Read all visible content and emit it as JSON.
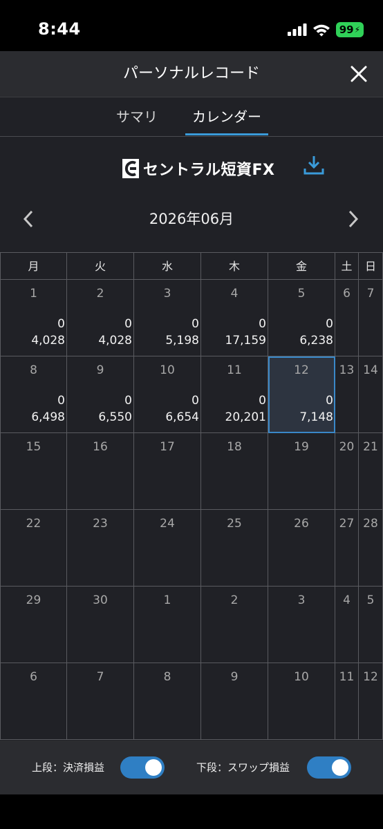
{
  "status_bar": {
    "time": "8:44",
    "battery": "99"
  },
  "header": {
    "title": "パーソナルレコード"
  },
  "tabs": [
    {
      "label": "サマリ",
      "active": false
    },
    {
      "label": "カレンダー",
      "active": true
    }
  ],
  "brand": {
    "name": "セントラル短資FX"
  },
  "month": {
    "label": "2026年06月"
  },
  "weekdays": [
    "月",
    "火",
    "水",
    "木",
    "金",
    "土",
    "日"
  ],
  "weeks": [
    {
      "days": [
        {
          "day": "1",
          "v1": "0",
          "v2": "4,028"
        },
        {
          "day": "2",
          "v1": "0",
          "v2": "4,028"
        },
        {
          "day": "3",
          "v1": "0",
          "v2": "5,198"
        },
        {
          "day": "4",
          "v1": "0",
          "v2": "17,159"
        },
        {
          "day": "5",
          "v1": "0",
          "v2": "6,238"
        },
        {
          "day": "6"
        },
        {
          "day": "7"
        }
      ]
    },
    {
      "days": [
        {
          "day": "8",
          "v1": "0",
          "v2": "6,498"
        },
        {
          "day": "9",
          "v1": "0",
          "v2": "6,550"
        },
        {
          "day": "10",
          "v1": "0",
          "v2": "6,654"
        },
        {
          "day": "11",
          "v1": "0",
          "v2": "20,201"
        },
        {
          "day": "12",
          "v1": "0",
          "v2": "7,148",
          "today": true
        },
        {
          "day": "13"
        },
        {
          "day": "14"
        }
      ]
    },
    {
      "days": [
        {
          "day": "15"
        },
        {
          "day": "16"
        },
        {
          "day": "17"
        },
        {
          "day": "18"
        },
        {
          "day": "19"
        },
        {
          "day": "20"
        },
        {
          "day": "21"
        }
      ]
    },
    {
      "days": [
        {
          "day": "22"
        },
        {
          "day": "23"
        },
        {
          "day": "24"
        },
        {
          "day": "25"
        },
        {
          "day": "26"
        },
        {
          "day": "27"
        },
        {
          "day": "28"
        }
      ]
    },
    {
      "days": [
        {
          "day": "29"
        },
        {
          "day": "30"
        },
        {
          "day": "1"
        },
        {
          "day": "2"
        },
        {
          "day": "3"
        },
        {
          "day": "4"
        },
        {
          "day": "5"
        }
      ]
    },
    {
      "days": [
        {
          "day": "6"
        },
        {
          "day": "7"
        },
        {
          "day": "8"
        },
        {
          "day": "9"
        },
        {
          "day": "10"
        },
        {
          "day": "11"
        },
        {
          "day": "12"
        }
      ]
    }
  ],
  "footer": {
    "upper_label": "上段：決済損益",
    "upper_on": true,
    "lower_label": "下段：スワップ損益",
    "lower_on": true
  },
  "colors": {
    "accent": "#3a9bd9",
    "background": "#202126",
    "today_outline": "#3a88c8"
  }
}
